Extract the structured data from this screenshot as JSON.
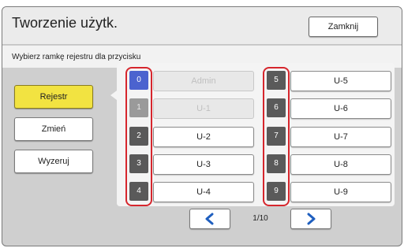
{
  "header": {
    "title": "Tworzenie użytk.",
    "close_label": "Zamknij"
  },
  "instruction": "Wybierz ramkę rejestru dla przycisku",
  "side_buttons": {
    "register": "Rejestr",
    "change": "Zmień",
    "reset": "Wyzeruj"
  },
  "left_column": [
    {
      "num": "0",
      "label": "Admin"
    },
    {
      "num": "1",
      "label": "U-1"
    },
    {
      "num": "2",
      "label": "U-2"
    },
    {
      "num": "3",
      "label": "U-3"
    },
    {
      "num": "4",
      "label": "U-4"
    }
  ],
  "right_column": [
    {
      "num": "5",
      "label": "U-5"
    },
    {
      "num": "6",
      "label": "U-6"
    },
    {
      "num": "7",
      "label": "U-7"
    },
    {
      "num": "8",
      "label": "U-8"
    },
    {
      "num": "9",
      "label": "U-9"
    }
  ],
  "pager": {
    "page": "1/10",
    "prev_icon": "chevron-left-icon",
    "next_icon": "chevron-right-icon"
  },
  "colors": {
    "accent_yellow": "#f2e341",
    "selected_blue": "#4b63cf",
    "highlight_red": "#d6262d",
    "arrow_blue": "#1f5fbf"
  }
}
